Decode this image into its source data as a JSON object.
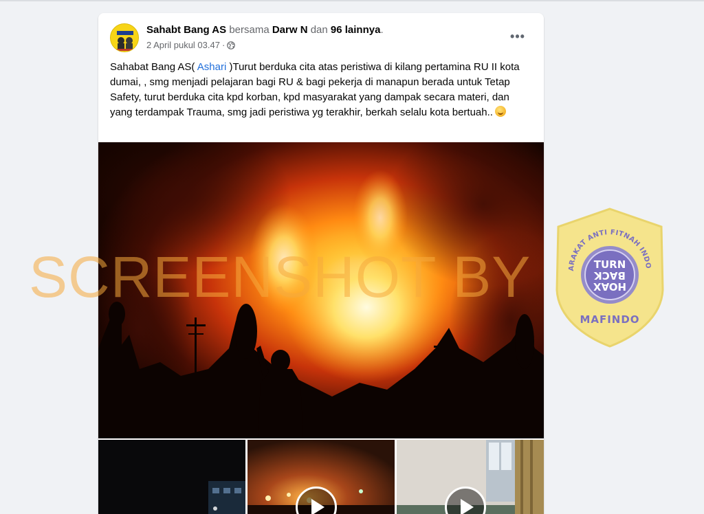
{
  "post": {
    "author": "Sahabt Bang AS",
    "with_word": "bersama",
    "tagged": "Darw N",
    "and_word": "dan",
    "others": "96 lainnya",
    "period": ".",
    "timestamp": "2 April pukul 03.47",
    "separator": "·",
    "audience_icon": "globe-icon",
    "more_label": "•••",
    "text_before_link": "Sahabat Bang AS(",
    "link_text": " Ashari ",
    "text_after_link": ")Turut berduka cita atas peristiwa di kilang pertamina RU II kota dumai, , smg menjadi pelajaran bagi RU & bagi pekerja di manapun berada untuk Tetap Safety, turut berduka cita kpd korban, kpd masyarakat yang dampak secara materi, dan yang terdampak Trauma, smg jadi peristiwa yg terakhir, berkah selalu kota bertuah..",
    "emoji_icon": "relieved-face-emoji"
  },
  "media": {
    "main_photo_icon": "refinery-fire-photo",
    "thumbnails": [
      {
        "icon": "night-scene-thumbnail",
        "is_video": false
      },
      {
        "icon": "fire-video-thumbnail",
        "is_video": true,
        "play_icon": "play-icon"
      },
      {
        "icon": "room-video-thumbnail",
        "is_video": true,
        "play_icon": "play-icon"
      }
    ]
  },
  "watermark": {
    "text": "SCREENSHOT BY",
    "badge_top_arc": "MASYARAKAT ANTI FITNAH INDONESIA",
    "badge_line1": "TURN",
    "badge_line2": "BACK",
    "badge_line3": "HOAX",
    "badge_bottom": "MAFINDO"
  },
  "colors": {
    "page_bg": "#f0f2f5",
    "card_bg": "#ffffff",
    "link": "#216fdb",
    "secondary_text": "#65676b",
    "watermark_orange": "#f5aa3c",
    "badge_yellow": "#f6e27a",
    "badge_purple": "#7a6fc0"
  }
}
